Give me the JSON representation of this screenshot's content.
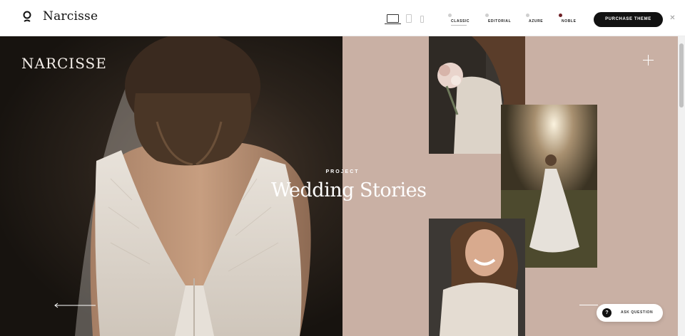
{
  "header": {
    "logo_text": "Narcisse",
    "devices": [
      "desktop-icon",
      "tablet-icon",
      "mobile-icon"
    ],
    "variants": [
      {
        "label": "CLASSIC",
        "active": true
      },
      {
        "label": "EDITORIAL",
        "active": false
      },
      {
        "label": "AZURE",
        "active": false
      },
      {
        "label": "NOBLE",
        "active": false
      }
    ],
    "purchase_label": "PURCHASE THEME",
    "close_icon": "close-icon"
  },
  "hero": {
    "brand": "NARCISSE",
    "kicker": "PROJECT",
    "title": "Wedding Stories"
  },
  "help": {
    "ask_label": "ASK QUESTION",
    "icon_glyph": "?"
  },
  "colors": {
    "accent_dark": "#111111",
    "panel_rose": "#c9b0a4",
    "noble_dot": "#6e1f25"
  }
}
